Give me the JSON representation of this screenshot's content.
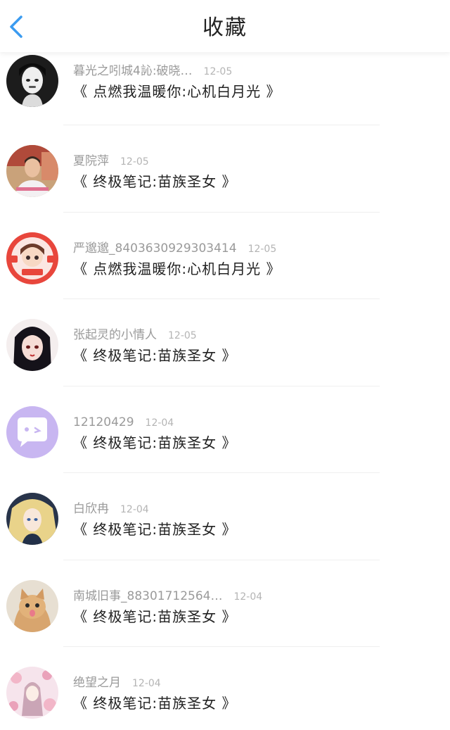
{
  "header": {
    "title": "收藏",
    "back_icon": "chevron-left-icon"
  },
  "colors": {
    "accent": "#3b9bf0",
    "text_primary": "#222222",
    "text_secondary": "#9a9a9a",
    "divider": "#efefef"
  },
  "items": [
    {
      "name": "暮光之吲城4訫:破晓…",
      "time": "12-05",
      "book": "《 点燃我温暖你:心机白月光 》",
      "avatar": "avatar-dark-portrait"
    },
    {
      "name": "夏院萍",
      "time": "12-05",
      "book": "《 终极笔记:苗族圣女 》",
      "avatar": "avatar-photo-portrait"
    },
    {
      "name": "严邈邈_8403630929303414",
      "time": "12-05",
      "book": "《 点燃我温暖你:心机白月光 》",
      "avatar": "avatar-cartoon-badge"
    },
    {
      "name": "张起灵的小情人",
      "time": "12-05",
      "book": "《 终极笔记:苗族圣女 》",
      "avatar": "avatar-anime-girl"
    },
    {
      "name": "12120429",
      "time": "12-04",
      "book": "《 终极笔记:苗族圣女 》",
      "avatar": "avatar-purple-chat"
    },
    {
      "name": "白欣冉",
      "time": "12-04",
      "book": "《 终极笔记:苗族圣女 》",
      "avatar": "avatar-blonde-anime"
    },
    {
      "name": "南城旧事_88301712564…",
      "time": "12-04",
      "book": "《 终极笔记:苗族圣女 》",
      "avatar": "avatar-cat"
    },
    {
      "name": "绝望之月",
      "time": "12-04",
      "book": "《 终极笔记:苗族圣女 》",
      "avatar": "avatar-pink-blossom"
    }
  ]
}
